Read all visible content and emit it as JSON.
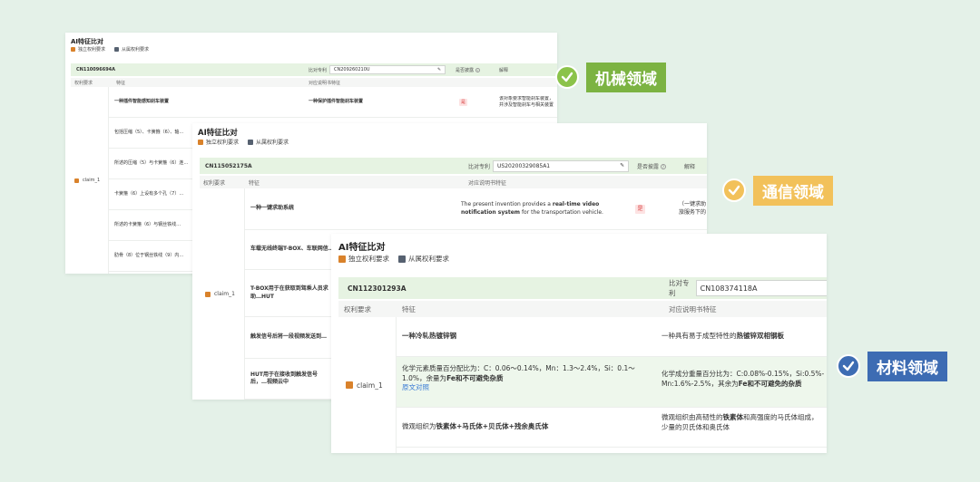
{
  "panel1": {
    "title": "AI特征比对",
    "legend_independent": "独立权利要求",
    "legend_dependent": "从属权利要求",
    "patent_no": "CN110096694A",
    "compare_label": "比对专利",
    "compare_value": "CN209260210U",
    "col_claim": "权利要求",
    "col_feature": "特征",
    "col_desc": "对应说明书特征",
    "col_consistent": "是否披露",
    "col_explain": "解释",
    "claim_label": "claim_1",
    "rows": [
      {
        "feature": "一种插件智能感知刹车装置",
        "desc": "一种保护插件智能刹车装置",
        "flag": "是",
        "explain": "该对象要求智能刹车装置，并涉及智能刹车与相关装置"
      },
      {
        "feature": "包括压缩（5）、卡簧箍（6）、轴…",
        "desc": "",
        "flag": "",
        "explain": ""
      },
      {
        "feature": "所述的压缩（5）与卡簧箍（6）连…",
        "desc": "",
        "flag": "",
        "explain": ""
      },
      {
        "feature": "卡簧箍（6）上设有多个孔（7）…",
        "desc": "",
        "flag": "",
        "explain": ""
      },
      {
        "feature": "所述的卡簧箍（6）与钢丝铁线…",
        "desc": "",
        "flag": "",
        "explain": ""
      },
      {
        "feature": "肋骨（8）位于钢丝铁线（9）内…",
        "desc": "",
        "flag": "",
        "explain": ""
      }
    ]
  },
  "panel2": {
    "title": "AI特征比对",
    "legend_independent": "独立权利要求",
    "legend_dependent": "从属权利要求",
    "patent_no": "CN115052175A",
    "compare_label": "比对专利",
    "compare_value": "US20200329085A1",
    "col_claim": "权利要求",
    "col_feature": "特征",
    "col_desc": "对应说明书特征",
    "col_consistent": "是否披露",
    "col_explain": "解释",
    "claim_label": "claim_1",
    "rows": [
      {
        "feature": "一种一键求助系统",
        "desc_pre": "The present invention provides a ",
        "desc_bold": "real-time video notification system",
        "desc_post": " for the transportation vehicle.",
        "flag": "是",
        "explain": "（一键求助 旅服务下的"
      },
      {
        "feature": "车载无线终端T-BOX、车联网信…",
        "flag": "",
        "explain": ""
      },
      {
        "feature": "T-BOX用于在获取到驾乘人员求助…HUT",
        "flag": "",
        "explain": ""
      },
      {
        "feature": "触发信号后将一段视频发送到…",
        "flag": "",
        "explain": ""
      },
      {
        "feature": "HUT用于在接收到触发信号后，…视频云中",
        "flag": "",
        "explain": ""
      }
    ]
  },
  "panel3": {
    "title": "AI特征比对",
    "legend_independent": "独立权利要求",
    "legend_dependent": "从属权利要求",
    "patent_no": "CN112301293A",
    "compare_label": "比对专利",
    "compare_value": "CN108374118A",
    "col_claim": "权利要求",
    "col_feature": "特征",
    "col_desc": "对应说明书特征",
    "claim_label": "claim_1",
    "row1_feature": "一种冷轧热镀锌钢",
    "row1_desc_pre": "一种具有易于成型特性的",
    "row1_desc_bold": "热镀锌双相钢板",
    "row2_feature_pre": "化学元素质量百分配比为：C：0.06～0.14%，Mn：1.3～2.4%，Si：0.1～1.0%，余量为",
    "row2_feature_bold": "Fe和不可避免杂质",
    "row2_link": "原文对照",
    "row2_desc_pre": "化学成分重量百分比为：C:0.08%-0.15%，Si:0.5%-",
    "row2_desc_mid": "Mn:1.6%-2.5%，其余为",
    "row2_desc_bold": "Fe和不可避免的杂质",
    "row3_feature_pre": "微观组织为",
    "row3_feature_bold": "铁素体+马氏体+贝氏体+残余奥氏体",
    "row3_desc_pre": "微观组织由高韧性的",
    "row3_desc_bold1": "铁素体",
    "row3_desc_mid": "和高强度的马氏体组成，",
    "row3_desc_line2": "少量的贝氏体和奥氏体"
  },
  "tags": {
    "mechanical": "机械领域",
    "communication": "通信领域",
    "materials": "材料领域"
  },
  "colors": {
    "background": "#e4f1e8",
    "header_green": "#e6f3e2",
    "independent_claim": "#d9822b",
    "dependent_claim": "#566170",
    "tag_mechanical": "#7cb342",
    "tag_communication": "#f2c15a",
    "tag_materials": "#3d6cb3"
  }
}
